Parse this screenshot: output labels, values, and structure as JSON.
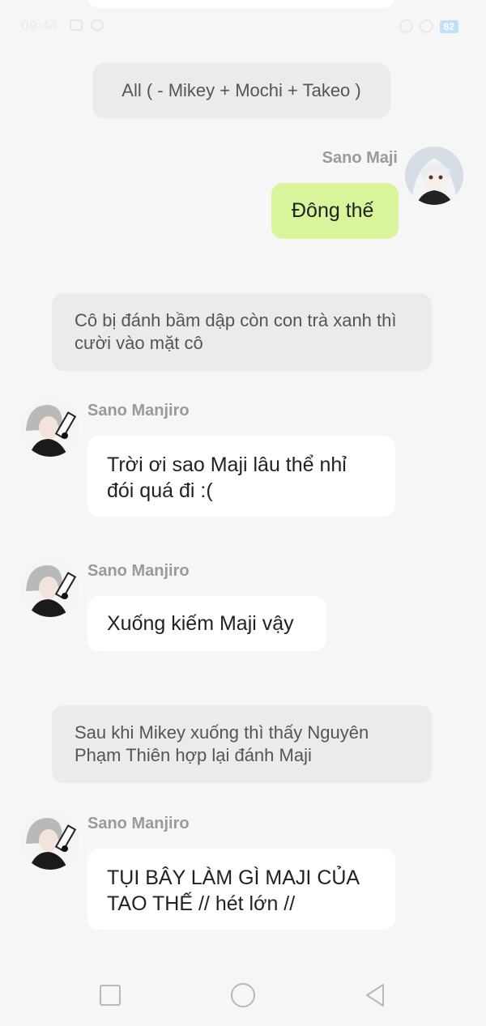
{
  "status": {
    "time": "09:44",
    "battery": "82"
  },
  "header": {
    "scene": "All ( - Mikey + Mochi + Takeo )"
  },
  "messages": [
    {
      "type": "sent",
      "sender": "Sano Maji",
      "text": "Đông thế"
    },
    {
      "type": "narration",
      "text": "Cô bị đánh bầm dập còn con trà xanh thì cười vào mặt cô"
    },
    {
      "type": "received",
      "sender": "Sano Manjiro",
      "text": "Trời ơi sao Maji lâu thể nhỉ đói quá đi :("
    },
    {
      "type": "received",
      "sender": "Sano Manjiro",
      "text": "Xuống kiếm Maji vậy"
    },
    {
      "type": "narration",
      "text": "Sau khi Mikey xuống thì thấy Nguyên Phạm Thiên hợp lại đánh Maji"
    },
    {
      "type": "received",
      "sender": "Sano Manjiro",
      "text": "TỤI BÂY LÀM GÌ MAJI CỦA TAO THẾ // hét lớn //"
    }
  ],
  "nav": {
    "recent_icon": "square-icon",
    "home_icon": "circle-icon",
    "back_icon": "triangle-back-icon"
  },
  "colors": {
    "background": "#f6f6f6",
    "sent_bubble": "#d8f59b",
    "received_bubble": "#ffffff",
    "narration_bubble": "#ebebeb",
    "sender_name": "#9a9a9a"
  }
}
